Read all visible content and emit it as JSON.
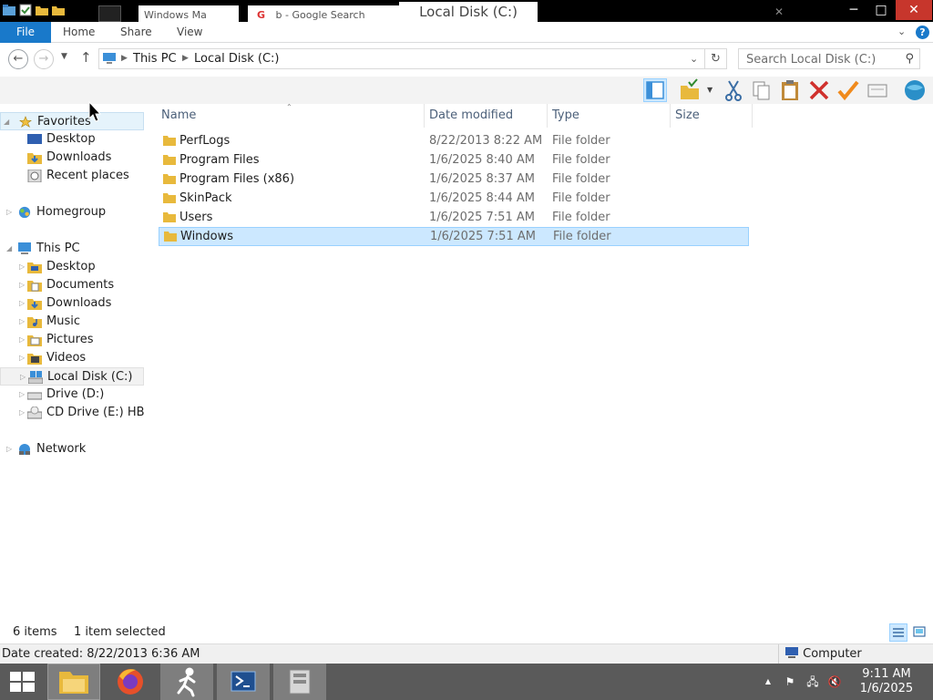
{
  "window": {
    "title": "Local Disk (C:)",
    "bg_tab_1": "Windows Ma",
    "bg_tab_2": "b - Google Search",
    "close_glyph": "✕",
    "max_glyph": "□",
    "min_glyph": "─"
  },
  "ribbon": {
    "tabs": [
      "File",
      "Home",
      "Share",
      "View"
    ]
  },
  "address": {
    "path": [
      "This PC",
      "Local Disk (C:)"
    ],
    "search_placeholder": "Search Local Disk (C:)"
  },
  "nav": {
    "favorites": "Favorites",
    "fav_items": [
      "Desktop",
      "Downloads",
      "Recent places"
    ],
    "homegroup": "Homegroup",
    "this_pc": "This PC",
    "pc_items": [
      "Desktop",
      "Documents",
      "Downloads",
      "Music",
      "Pictures",
      "Videos",
      "Local Disk (C:)",
      "Drive (D:)",
      "CD Drive (E:) HBC"
    ],
    "network": "Network"
  },
  "columns": [
    "Name",
    "Date modified",
    "Type",
    "Size"
  ],
  "files": [
    {
      "name": "PerfLogs",
      "date": "8/22/2013 8:22 AM",
      "type": "File folder"
    },
    {
      "name": "Program Files",
      "date": "1/6/2025 8:40 AM",
      "type": "File folder"
    },
    {
      "name": "Program Files (x86)",
      "date": "1/6/2025 8:37 AM",
      "type": "File folder"
    },
    {
      "name": "SkinPack",
      "date": "1/6/2025 8:44 AM",
      "type": "File folder"
    },
    {
      "name": "Users",
      "date": "1/6/2025 7:51 AM",
      "type": "File folder"
    },
    {
      "name": "Windows",
      "date": "1/6/2025 7:51 AM",
      "type": "File folder"
    }
  ],
  "status": {
    "count": "6 items",
    "selected": "1 item selected",
    "details": "Date created: 8/22/2013 6:36 AM",
    "zone": "Computer"
  },
  "clock": {
    "time": "9:11 AM",
    "date": "1/6/2025"
  },
  "colors": {
    "accent": "#1979ca",
    "selection": "#cce8ff",
    "folder": "#e8b93c",
    "close": "#c7362c"
  }
}
